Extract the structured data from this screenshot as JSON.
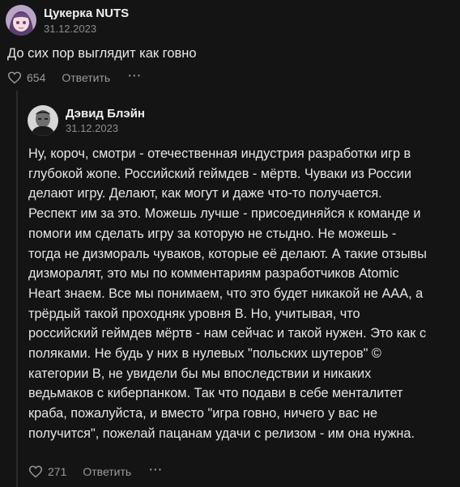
{
  "root_comment": {
    "author": "Цукерка NUTS",
    "date": "31.12.2023",
    "text": "До сих пор выглядит как говно",
    "likes": "654",
    "reply_label": "Ответить",
    "more_label": "···"
  },
  "reply_comment": {
    "author": "Дэвид Блэйн",
    "date": "31.12.2023",
    "text_lines": [
      "Ну, короч, смотри - отечественная индустрия разработки игр в",
      "глубокой жопе. Российский геймдев - мёртв. Чуваки из России",
      "делают игру. Делают, как могут и даже что-то получается.",
      "Респект им за это. Можешь лучше - присоединяйся к команде и",
      "помоги им сделать игру за которую не стыдно. Не можешь -",
      "тогда не дизмораль чуваков, которые её делают. А такие отзывы",
      "дизморалят, это мы по комментариям разработчиков Atomic",
      "Heart знаем. Все мы понимаем, что это будет никакой не ААА, а",
      "трёрдый такой проходняк уровня B. Но, учитывая, что",
      "российский геймдев мёртв - нам сейчас и такой нужен. Это как с",
      "поляками. Не будь у них в нулевых \"польских шутеров\" ©",
      "категории B, не увидели бы мы впоследствии и никаких",
      "ведьмаков с киберпанком. Так что подави в себе менталитет",
      "краба, пожалуйста, и вместо \"игра говно, ничего у вас не",
      "получится\", пожелай пацанам удачи с релизом - им она нужна."
    ],
    "likes": "271",
    "reply_label": "Ответить",
    "more_label": "···"
  },
  "colors": {
    "background": "#141414",
    "text": "#e6e6e6",
    "muted": "#8d8d8d"
  },
  "icons": [
    "anime-avatar",
    "photo-avatar",
    "heart-icon",
    "more-icon"
  ]
}
